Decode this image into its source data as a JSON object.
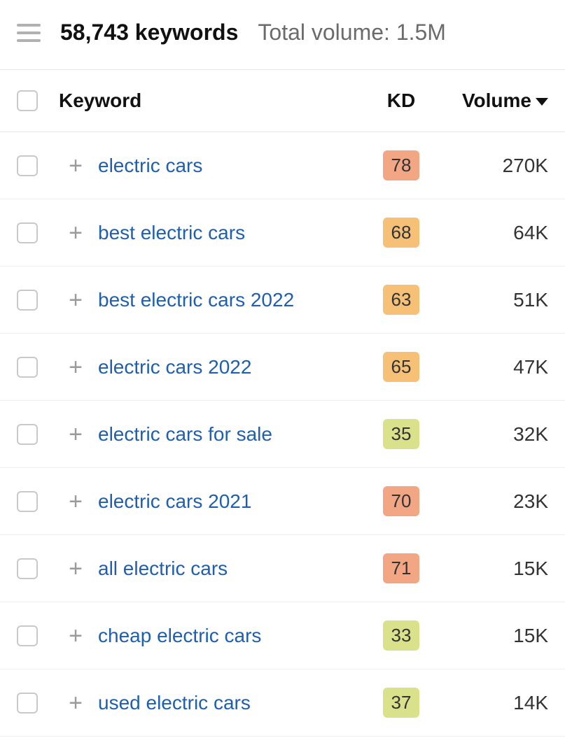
{
  "summary": {
    "keyword_count": "58,743 keywords",
    "total_volume": "Total volume: 1.5M"
  },
  "columns": {
    "keyword": "Keyword",
    "kd": "KD",
    "volume": "Volume"
  },
  "rows": [
    {
      "keyword": "electric cars",
      "kd": "78",
      "kd_color": "#f3a683",
      "volume": "270K"
    },
    {
      "keyword": "best electric cars",
      "kd": "68",
      "kd_color": "#f6c177",
      "volume": "64K"
    },
    {
      "keyword": "best electric cars 2022",
      "kd": "63",
      "kd_color": "#f6c177",
      "volume": "51K"
    },
    {
      "keyword": "electric cars 2022",
      "kd": "65",
      "kd_color": "#f6c177",
      "volume": "47K"
    },
    {
      "keyword": "electric cars for sale",
      "kd": "35",
      "kd_color": "#d9e28a",
      "volume": "32K"
    },
    {
      "keyword": "electric cars 2021",
      "kd": "70",
      "kd_color": "#f3a683",
      "volume": "23K"
    },
    {
      "keyword": "all electric cars",
      "kd": "71",
      "kd_color": "#f3a683",
      "volume": "15K"
    },
    {
      "keyword": "cheap electric cars",
      "kd": "33",
      "kd_color": "#d9e28a",
      "volume": "15K"
    },
    {
      "keyword": "used electric cars",
      "kd": "37",
      "kd_color": "#d9e28a",
      "volume": "14K"
    }
  ]
}
